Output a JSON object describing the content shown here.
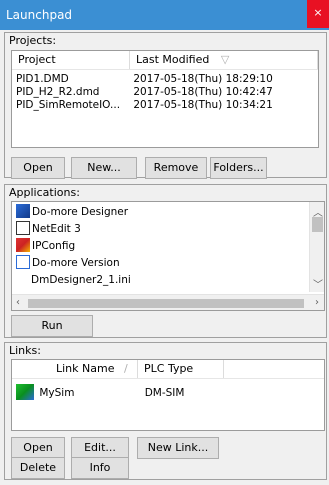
{
  "window": {
    "title": "Launchpad",
    "close_label": "×"
  },
  "projects": {
    "label": "Projects:",
    "columns": [
      "Project",
      "Last Modified"
    ],
    "rows": [
      {
        "name": "PID1.DMD",
        "modified": "2017-05-18(Thu) 18:29:10"
      },
      {
        "name": "PID_H2_R2.dmd",
        "modified": "2017-05-18(Thu) 10:42:47"
      },
      {
        "name": "PID_SimRemoteIO...",
        "modified": "2017-05-18(Thu) 10:34:21"
      }
    ],
    "buttons": {
      "open": "Open",
      "new": "New...",
      "remove": "Remove",
      "folders": "Folders..."
    }
  },
  "applications": {
    "label": "Applications:",
    "items": [
      {
        "name": "Do-more Designer",
        "icon": "do-more-designer-icon"
      },
      {
        "name": "NetEdit 3",
        "icon": "netedit-icon"
      },
      {
        "name": "IPConfig",
        "icon": "ipconfig-icon"
      },
      {
        "name": "Do-more Version",
        "icon": "do-more-version-icon"
      },
      {
        "name": "DmDesigner2_1.ini",
        "icon": ""
      }
    ],
    "run_label": "Run"
  },
  "links": {
    "label": "Links:",
    "columns": [
      "Link Name",
      "PLC Type"
    ],
    "rows": [
      {
        "name": "MySim",
        "type": "DM-SIM"
      }
    ],
    "buttons": {
      "open": "Open",
      "edit": "Edit...",
      "new_link": "New Link...",
      "delete": "Delete",
      "info": "Info"
    }
  }
}
